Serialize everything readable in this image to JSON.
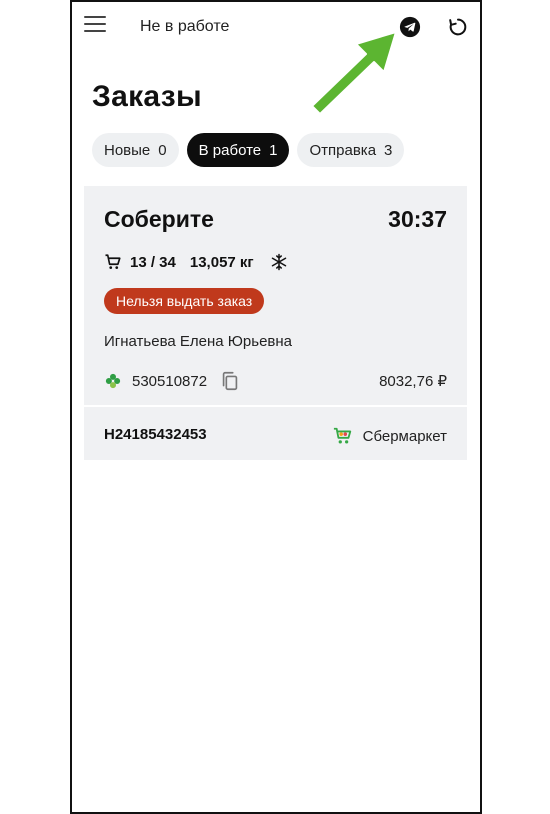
{
  "header": {
    "status": "Не в работе",
    "icons": {
      "menu": "menu-icon",
      "telegram": "telegram-icon",
      "refresh": "refresh-icon"
    }
  },
  "page_title": "Заказы",
  "tabs": [
    {
      "label": "Новые",
      "count": "0",
      "active": false
    },
    {
      "label": "В работе",
      "count": "1",
      "active": true
    },
    {
      "label": "Отправка",
      "count": "3",
      "active": false
    }
  ],
  "order": {
    "title": "Соберите",
    "timer": "30:37",
    "items": "13 / 34",
    "weight": "13,057 кг",
    "badge": "Нельзя выдать заказ",
    "client": "Игнатьева Елена  Юрьевна",
    "phone": "530510872",
    "sum": "8032,76 ₽",
    "number": "Н24185432453",
    "shop": "Сбермаркет"
  },
  "colors": {
    "accent": "#0d0d0d",
    "badge": "#c0391c",
    "card_bg": "#f0f1f3",
    "arrow": "#5cb531"
  }
}
